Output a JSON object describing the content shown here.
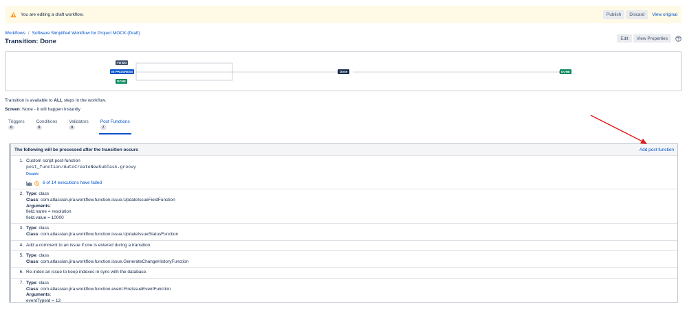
{
  "banner": {
    "message": "You are editing a draft workflow.",
    "publish_label": "Publish",
    "discard_label": "Discard",
    "view_original_label": "View original"
  },
  "breadcrumb": {
    "root": "Workflows",
    "separator": "/",
    "workflow": "Software Simplified Workflow for Project MOCK (Draft)"
  },
  "page_title": "Transition: Done",
  "header_actions": {
    "edit_label": "Edit",
    "view_properties_label": "View Properties"
  },
  "diagram": {
    "source_statuses": [
      "TO DO",
      "IN PROGRESS",
      "DONE"
    ],
    "transition_name": "Done",
    "target_status": "DONE"
  },
  "info": {
    "availability_prefix": "Transition is available to ",
    "availability_bold": "ALL",
    "availability_suffix": " steps in the workflow.",
    "screen_label": "Screen",
    "screen_value": ": None - it will happen instantly"
  },
  "tabs": [
    {
      "label": "Triggers",
      "count": "0"
    },
    {
      "label": "Conditions",
      "count": "0"
    },
    {
      "label": "Validators",
      "count": "0"
    },
    {
      "label": "Post Functions",
      "count": "7"
    }
  ],
  "panel": {
    "title": "The following will be processed after the transition occurs",
    "add_label": "Add post function"
  },
  "post_functions": {
    "f1": {
      "num": "1.",
      "title": "Custom script post-function",
      "path": "post_function/AutoCreateNewSubTask.groovy",
      "disable_label": "Disable",
      "executions": "6 of 14 executions have failed"
    },
    "f2": {
      "num": "2.",
      "type_label": "Type",
      "type_value": ": class",
      "class_label": "Class",
      "class_value": ": com.atlassian.jira.workflow.function.issue.UpdateIssueFieldFunction",
      "args_label": "Arguments",
      "args_colon": ":",
      "arg1": "field.name = resolution",
      "arg2": "field.value = 10000"
    },
    "f3": {
      "num": "3.",
      "type_label": "Type",
      "type_value": ": class",
      "class_label": "Class",
      "class_value": ": com.atlassian.jira.workflow.function.issue.UpdateIssueStatusFunction"
    },
    "f4": {
      "num": "4.",
      "text": "Add a comment to an issue if one is entered during a transition."
    },
    "f5": {
      "num": "5.",
      "type_label": "Type",
      "type_value": ": class",
      "class_label": "Class",
      "class_value": ": com.atlassian.jira.workflow.function.issue.GenerateChangeHistoryFunction"
    },
    "f6": {
      "num": "6.",
      "text": "Re-index an issue to keep indexes in sync with the database."
    },
    "f7": {
      "num": "7.",
      "type_label": "Type",
      "type_value": ": class",
      "class_label": "Class",
      "class_value": ": com.atlassian.jira.workflow.function.event.FireIssueEventFunction",
      "args_label": "Arguments",
      "args_colon": ":",
      "arg1": "eventTypeId = 13"
    }
  },
  "colors": {
    "link": "#0052cc",
    "warning_bg": "#fffae6",
    "warning_icon": "#ff991f",
    "annotation_arrow": "#e01b1b",
    "status_todo": "#42526e",
    "status_in_progress": "#0052cc",
    "status_done": "#00875a"
  }
}
